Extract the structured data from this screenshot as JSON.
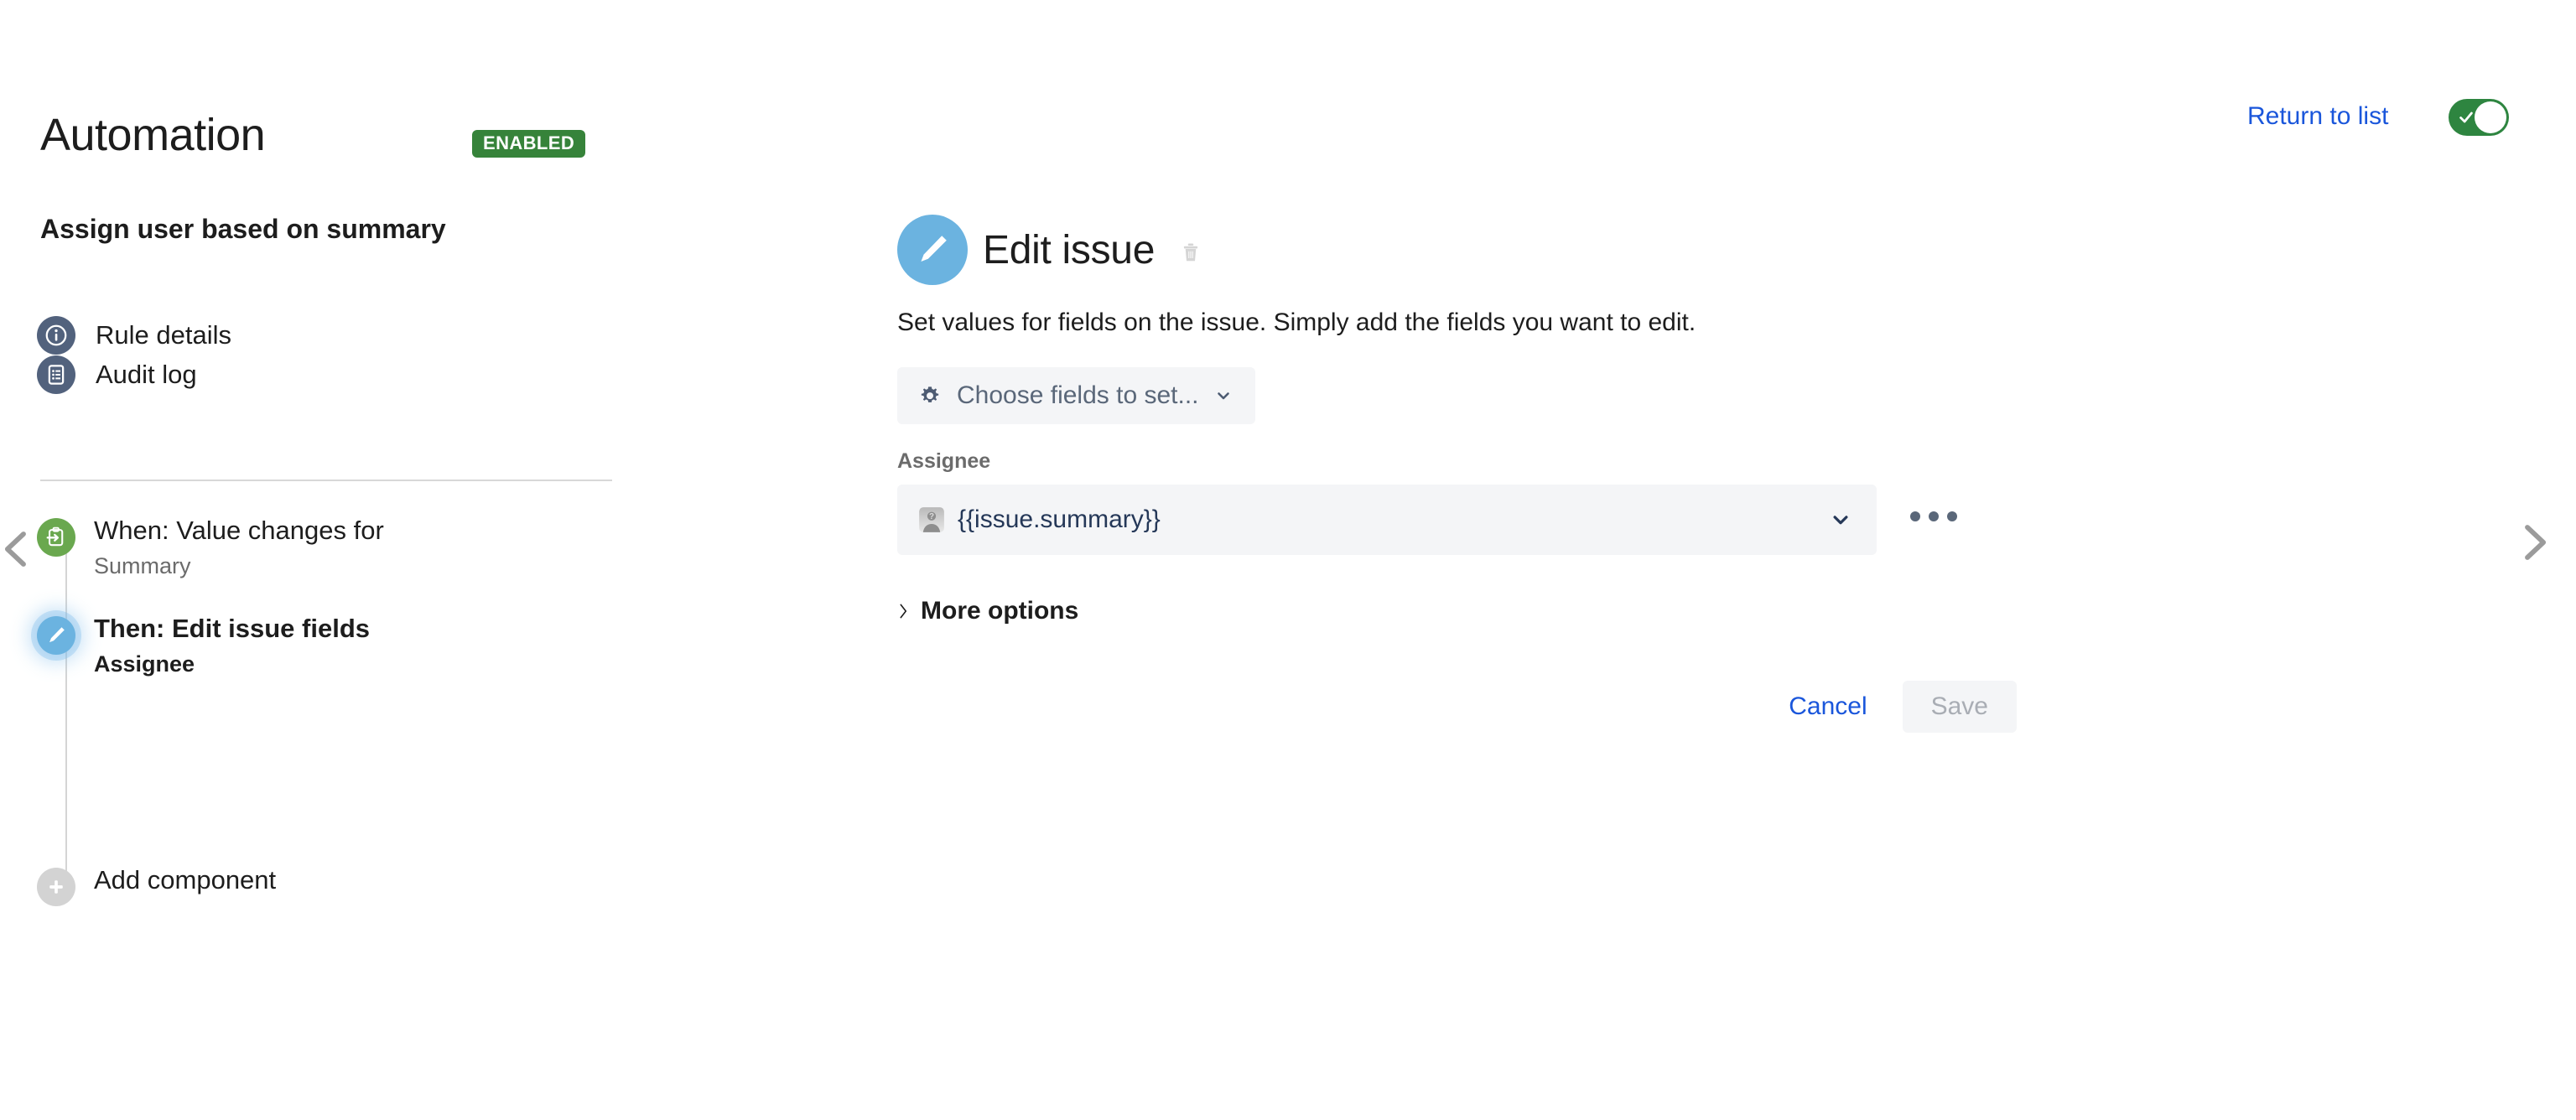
{
  "header": {
    "page_title": "Automation",
    "status_badge": "ENABLED",
    "rule_name": "Assign user based on summary",
    "return_to_list": "Return to list",
    "toggle_state": "on",
    "accent_blue": "#1a56db",
    "badge_green": "#36833a",
    "toggle_green": "#2e8540"
  },
  "sidebar": {
    "nav_items": [
      {
        "label": "Rule details",
        "icon": "info-circle-icon"
      },
      {
        "label": "Audit log",
        "icon": "list-document-icon"
      }
    ],
    "tree": [
      {
        "title": "When: Value changes for",
        "subtitle": "Summary",
        "icon": "trigger-clipboard-icon",
        "color": "#6aa84f",
        "selected": false
      },
      {
        "title": "Then: Edit issue fields",
        "subtitle": "Assignee",
        "icon": "pencil-icon",
        "color": "#6bb3e0",
        "selected": true
      },
      {
        "title": "Add component",
        "subtitle": "",
        "icon": "plus-icon",
        "color": "#d3d3d3",
        "selected": false
      }
    ]
  },
  "main": {
    "component_title": "Edit issue",
    "component_icon": "pencil-icon",
    "delete_icon": "trash-icon",
    "description": "Set values for fields on the issue. Simply add the fields you want to edit.",
    "choose_fields": {
      "label": "Choose fields to set...",
      "icon": "gear-icon",
      "chevron": "chevron-down-icon"
    },
    "fields": [
      {
        "label": "Assignee",
        "value": "{{issue.summary}}",
        "avatar_icon": "anonymous-user-avatar-icon",
        "chevron": "chevron-down-icon",
        "overflow": "ellipsis-icon"
      }
    ],
    "more_options": {
      "label": "More options",
      "expanded": false,
      "chevron": "chevron-right-icon"
    },
    "actions": {
      "cancel_label": "Cancel",
      "save_label": "Save",
      "save_disabled": true
    }
  },
  "navigation": {
    "prev_chevron": "chevron-left-icon",
    "next_chevron": "chevron-right-icon"
  }
}
